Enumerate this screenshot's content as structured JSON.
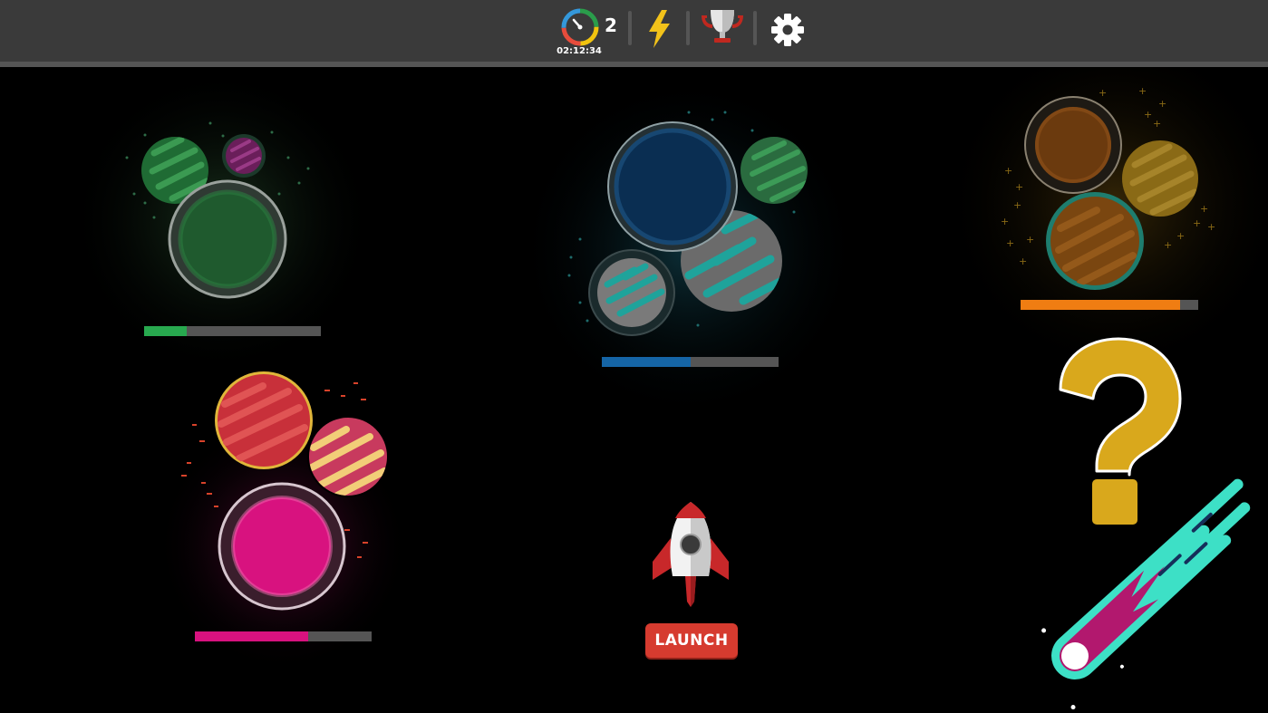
{
  "topbar": {
    "timer": {
      "count": "2",
      "time": "02:12:34",
      "icon": "stopwatch-icon"
    },
    "power_icon": "lightning-bolt-icon",
    "trophy_icon": "trophy-icon",
    "settings_icon": "gear-icon"
  },
  "clusters": [
    {
      "id": "green",
      "color": "#28a94f",
      "progress": 0.24
    },
    {
      "id": "blue",
      "color": "#1565a6",
      "progress": 0.5
    },
    {
      "id": "orange",
      "color": "#f07d12",
      "progress": 0.9
    },
    {
      "id": "pink",
      "color": "#d8127f",
      "progress": 0.64
    }
  ],
  "mystery": {
    "icon": "question-mark-icon",
    "color": "#d9a81c"
  },
  "comet": {
    "icon": "comet-icon",
    "color": "#3de0c6"
  },
  "launch": {
    "label": "LAUNCH",
    "icon": "rocket-icon"
  }
}
